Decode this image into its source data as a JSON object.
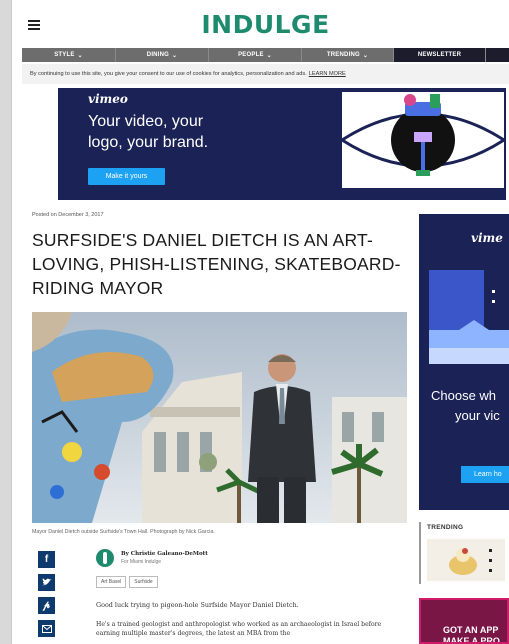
{
  "header": {
    "logo": "INDULGE",
    "menu_icon": "hamburger-icon"
  },
  "nav": {
    "items": [
      {
        "label": "STYLE",
        "has_dropdown": true
      },
      {
        "label": "DINING",
        "has_dropdown": true
      },
      {
        "label": "PEOPLE",
        "has_dropdown": true
      },
      {
        "label": "TRENDING",
        "has_dropdown": true
      },
      {
        "label": "NEWSLETTER",
        "has_dropdown": false
      }
    ],
    "chevron": "⌄"
  },
  "cookie_bar": {
    "text": "By continuing to use this site, you give your consent to our use of cookies for analytics, personalization and ads.",
    "link": "LEARN MORE"
  },
  "ad_top": {
    "brand": "vimeo",
    "tagline_line1": "Your video, your",
    "tagline_line2": "logo, your brand.",
    "cta": "Make it yours"
  },
  "article": {
    "posted": "Posted on December 3, 2017",
    "headline": "SURFSIDE'S DANIEL DIETCH IS AN ART-LOVING, PHISH-LISTENING, SKATEBOARD-RIDING MAYOR",
    "caption": "Mayor Daniel Dietch outside Surfside's Town Hall. Photograph by Nick Garcia.",
    "author": "By Christie Galeano-DeMott",
    "author_org": "For Miami Indulge",
    "tags": [
      "Art Basel",
      "Surfside"
    ],
    "p1": "Good luck trying to pigeon-hole Surfside Mayor Daniel Dietch.",
    "p2": "He's a trained geologist and anthropologist who worked as an archaeologist in Israel before earning multiple master's degrees, the latest an MBA from the"
  },
  "social": [
    "facebook-icon",
    "twitter-icon",
    "pinterest-icon",
    "email-icon"
  ],
  "ad_right": {
    "brand": "vime",
    "copy_line1": "Choose wh",
    "copy_line2": "your vic",
    "cta": "Learn ho"
  },
  "trending": {
    "label": "TRENDING"
  },
  "ad_app": {
    "line1": "GOT AN APP",
    "line2": "MAKE A PRO"
  },
  "colors": {
    "brand_green": "#1e8a6e",
    "nav_gray": "#6d6d6d",
    "ad_navy": "#1a2256",
    "cta_blue": "#1da1f2",
    "social_navy": "#0f3a6e"
  }
}
